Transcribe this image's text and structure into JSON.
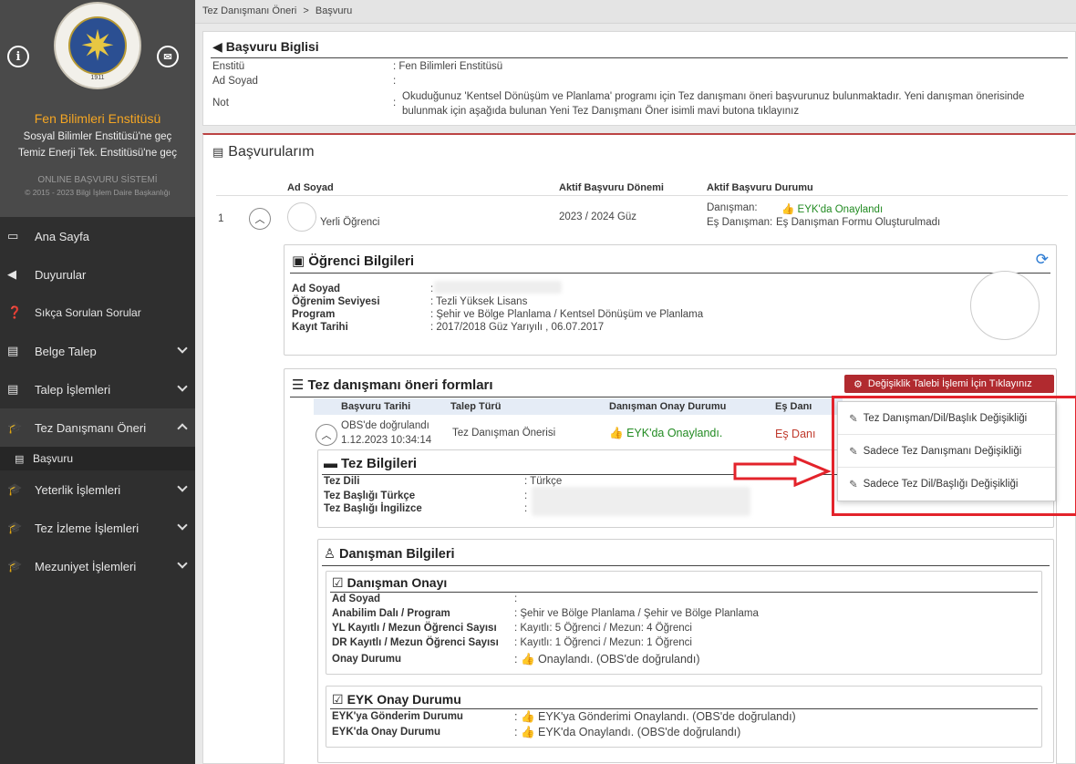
{
  "breadcrumb": {
    "parent": "Tez Danışmanı Öneri",
    "sep": ">",
    "current": "Başvuru"
  },
  "sidebar": {
    "institute": "Fen Bilimleri Enstitüsü",
    "switch1": "Sosyal Bilimler Enstitüsü'ne geç",
    "switch2": "Temiz Enerji Tek. Enstitüsü'ne geç",
    "system": "ONLINE BAŞVURU SİSTEMİ",
    "copyright": "© 2015 - 2023 Bilgi İşlem Daire Başkanlığı",
    "logo_year": "1911",
    "items": [
      {
        "label": "Ana Sayfa",
        "icon": "monitor-icon"
      },
      {
        "label": "Duyurular",
        "icon": "bullhorn-icon"
      },
      {
        "label": "Sıkça Sorulan Sorular",
        "icon": "question-icon"
      },
      {
        "label": "Belge Talep",
        "icon": "file-icon"
      },
      {
        "label": "Talep İşlemleri",
        "icon": "file-icon"
      },
      {
        "label": "Tez Danışmanı Öneri",
        "icon": "graduation-cap-icon"
      },
      {
        "label": "Başvuru",
        "icon": "file-icon"
      },
      {
        "label": "Yeterlik İşlemleri",
        "icon": "graduation-cap-icon"
      },
      {
        "label": "Tez İzleme İşlemleri",
        "icon": "graduation-cap-icon"
      },
      {
        "label": "Mezuniyet İşlemleri",
        "icon": "graduation-cap-icon"
      }
    ]
  },
  "application_info": {
    "title": "Başvuru Biglisi",
    "institute_label": "Enstitü",
    "institute_value": ": Fen Bilimleri Enstitüsü",
    "name_label": "Ad Soyad",
    "colon": ":",
    "note_label": "Not",
    "note_text": "Okuduğunuz 'Kentsel Dönüşüm ve Planlama' programı için Tez danışmanı öneri başvurunuz bulunmaktadır. Yeni danışman önerisinde bulunmak için aşağıda bulunan Yeni Tez Danışmanı Öner isimli mavi butona tıklayınız"
  },
  "applications": {
    "title": "Başvurularım",
    "headers": {
      "name": "Ad Soyad",
      "period": "Aktif Başvuru Dönemi",
      "status": "Aktif Başvuru Durumu"
    },
    "row": {
      "index": "1",
      "name": "Yerli Öğrenci",
      "period": "2023 / 2024 Güz",
      "advisor_label": "Danışman:",
      "advisor_status": "EYK'da Onaylandı",
      "co_advisor_label": "Eş Danışman:",
      "co_advisor_status": "Eş Danışman Formu Oluşturulmadı"
    }
  },
  "student_info": {
    "title": "Öğrenci Bilgileri",
    "name_label": "Ad Soyad",
    "level_label": "Öğrenim Seviyesi",
    "level_value": ": Tezli Yüksek Lisans",
    "program_label": "Program",
    "program_value": ": Şehir ve Bölge Planlama / Kentsel Dönüşüm ve Planlama",
    "reg_label": "Kayıt Tarihi",
    "reg_value": ": 2017/2018 Güz Yarıyılı , 06.07.2017"
  },
  "forms": {
    "title": "Tez danışmanı öneri formları",
    "change_button": "Değişiklik Talebi İşlemi İçin Tıklayınız",
    "headers": {
      "date": "Başvuru Tarihi",
      "type": "Talep Türü",
      "advisor_status": "Danışman Onay Durumu",
      "co_advisor_status": "Eş Danı"
    },
    "row": {
      "verified": "OBS'de doğrulandı",
      "date": "1.12.2023 10:34:14",
      "type": "Tez Danışman Önerisi",
      "advisor_status": "EYK'da Onaylandı.",
      "co_advisor_status": "Eş Danı"
    }
  },
  "dropdown": {
    "items": [
      "Tez Danışman/Dil/Başlık Değişikliği",
      "Sadece Tez Danışmanı Değişikliği",
      "Sadece Tez Dil/Başlığı Değişikliği"
    ]
  },
  "thesis_info": {
    "title": "Tez Bilgileri",
    "lang_label": "Tez Dili",
    "lang_value": ": Türkçe",
    "title_tr_label": "Tez Başlığı Türkçe",
    "title_en_label": "Tez Başlığı İngilizce"
  },
  "advisor_info": {
    "title": "Danışman Bilgileri",
    "approval_title": "Danışman Onayı",
    "name_label": "Ad Soyad",
    "dept_label": "Anabilim Dalı / Program",
    "dept_value": ": Şehir ve Bölge Planlama / Şehir ve Bölge Planlama",
    "yl_label": "YL Kayıtlı / Mezun Öğrenci Sayısı",
    "yl_value": ": Kayıtlı: 5 Öğrenci / Mezun: 4 Öğrenci",
    "dr_label": "DR Kayıtlı / Mezun Öğrenci Sayısı",
    "dr_value": ": Kayıtlı: 1 Öğrenci / Mezun: 1 Öğrenci",
    "status_label": "Onay Durumu",
    "status_value": "Onaylandı. (OBS'de doğrulandı)"
  },
  "eyk_info": {
    "title": "EYK Onay Durumu",
    "sent_label": "EYK'ya Gönderim Durumu",
    "sent_value": "EYK'ya Gönderimi Onaylandı. (OBS'de doğrulandı)",
    "approval_label": "EYK'da Onay Durumu",
    "approval_value": "EYK'da Onaylandı. (OBS'de doğrulandı)"
  },
  "colors": {
    "sidebar_bg": "#2f2f2f",
    "accent_orange": "#f5a623",
    "button_red": "#b12a2f",
    "success_green": "#228b22",
    "annotation_red": "#e3232b"
  }
}
